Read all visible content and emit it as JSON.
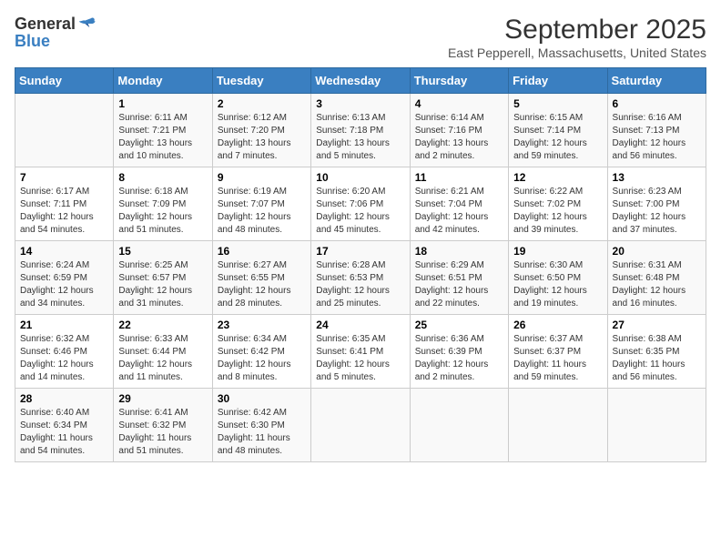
{
  "header": {
    "logo_general": "General",
    "logo_blue": "Blue",
    "month_title": "September 2025",
    "subtitle": "East Pepperell, Massachusetts, United States"
  },
  "days_of_week": [
    "Sunday",
    "Monday",
    "Tuesday",
    "Wednesday",
    "Thursday",
    "Friday",
    "Saturday"
  ],
  "weeks": [
    [
      {
        "day": "",
        "info": ""
      },
      {
        "day": "1",
        "info": "Sunrise: 6:11 AM\nSunset: 7:21 PM\nDaylight: 13 hours\nand 10 minutes."
      },
      {
        "day": "2",
        "info": "Sunrise: 6:12 AM\nSunset: 7:20 PM\nDaylight: 13 hours\nand 7 minutes."
      },
      {
        "day": "3",
        "info": "Sunrise: 6:13 AM\nSunset: 7:18 PM\nDaylight: 13 hours\nand 5 minutes."
      },
      {
        "day": "4",
        "info": "Sunrise: 6:14 AM\nSunset: 7:16 PM\nDaylight: 13 hours\nand 2 minutes."
      },
      {
        "day": "5",
        "info": "Sunrise: 6:15 AM\nSunset: 7:14 PM\nDaylight: 12 hours\nand 59 minutes."
      },
      {
        "day": "6",
        "info": "Sunrise: 6:16 AM\nSunset: 7:13 PM\nDaylight: 12 hours\nand 56 minutes."
      }
    ],
    [
      {
        "day": "7",
        "info": "Sunrise: 6:17 AM\nSunset: 7:11 PM\nDaylight: 12 hours\nand 54 minutes."
      },
      {
        "day": "8",
        "info": "Sunrise: 6:18 AM\nSunset: 7:09 PM\nDaylight: 12 hours\nand 51 minutes."
      },
      {
        "day": "9",
        "info": "Sunrise: 6:19 AM\nSunset: 7:07 PM\nDaylight: 12 hours\nand 48 minutes."
      },
      {
        "day": "10",
        "info": "Sunrise: 6:20 AM\nSunset: 7:06 PM\nDaylight: 12 hours\nand 45 minutes."
      },
      {
        "day": "11",
        "info": "Sunrise: 6:21 AM\nSunset: 7:04 PM\nDaylight: 12 hours\nand 42 minutes."
      },
      {
        "day": "12",
        "info": "Sunrise: 6:22 AM\nSunset: 7:02 PM\nDaylight: 12 hours\nand 39 minutes."
      },
      {
        "day": "13",
        "info": "Sunrise: 6:23 AM\nSunset: 7:00 PM\nDaylight: 12 hours\nand 37 minutes."
      }
    ],
    [
      {
        "day": "14",
        "info": "Sunrise: 6:24 AM\nSunset: 6:59 PM\nDaylight: 12 hours\nand 34 minutes."
      },
      {
        "day": "15",
        "info": "Sunrise: 6:25 AM\nSunset: 6:57 PM\nDaylight: 12 hours\nand 31 minutes."
      },
      {
        "day": "16",
        "info": "Sunrise: 6:27 AM\nSunset: 6:55 PM\nDaylight: 12 hours\nand 28 minutes."
      },
      {
        "day": "17",
        "info": "Sunrise: 6:28 AM\nSunset: 6:53 PM\nDaylight: 12 hours\nand 25 minutes."
      },
      {
        "day": "18",
        "info": "Sunrise: 6:29 AM\nSunset: 6:51 PM\nDaylight: 12 hours\nand 22 minutes."
      },
      {
        "day": "19",
        "info": "Sunrise: 6:30 AM\nSunset: 6:50 PM\nDaylight: 12 hours\nand 19 minutes."
      },
      {
        "day": "20",
        "info": "Sunrise: 6:31 AM\nSunset: 6:48 PM\nDaylight: 12 hours\nand 16 minutes."
      }
    ],
    [
      {
        "day": "21",
        "info": "Sunrise: 6:32 AM\nSunset: 6:46 PM\nDaylight: 12 hours\nand 14 minutes."
      },
      {
        "day": "22",
        "info": "Sunrise: 6:33 AM\nSunset: 6:44 PM\nDaylight: 12 hours\nand 11 minutes."
      },
      {
        "day": "23",
        "info": "Sunrise: 6:34 AM\nSunset: 6:42 PM\nDaylight: 12 hours\nand 8 minutes."
      },
      {
        "day": "24",
        "info": "Sunrise: 6:35 AM\nSunset: 6:41 PM\nDaylight: 12 hours\nand 5 minutes."
      },
      {
        "day": "25",
        "info": "Sunrise: 6:36 AM\nSunset: 6:39 PM\nDaylight: 12 hours\nand 2 minutes."
      },
      {
        "day": "26",
        "info": "Sunrise: 6:37 AM\nSunset: 6:37 PM\nDaylight: 11 hours\nand 59 minutes."
      },
      {
        "day": "27",
        "info": "Sunrise: 6:38 AM\nSunset: 6:35 PM\nDaylight: 11 hours\nand 56 minutes."
      }
    ],
    [
      {
        "day": "28",
        "info": "Sunrise: 6:40 AM\nSunset: 6:34 PM\nDaylight: 11 hours\nand 54 minutes."
      },
      {
        "day": "29",
        "info": "Sunrise: 6:41 AM\nSunset: 6:32 PM\nDaylight: 11 hours\nand 51 minutes."
      },
      {
        "day": "30",
        "info": "Sunrise: 6:42 AM\nSunset: 6:30 PM\nDaylight: 11 hours\nand 48 minutes."
      },
      {
        "day": "",
        "info": ""
      },
      {
        "day": "",
        "info": ""
      },
      {
        "day": "",
        "info": ""
      },
      {
        "day": "",
        "info": ""
      }
    ]
  ]
}
